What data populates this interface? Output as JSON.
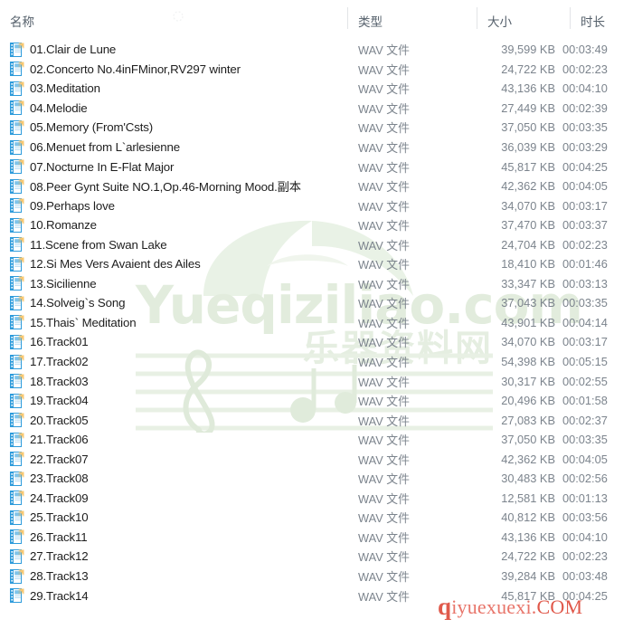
{
  "window": {
    "view_type": "file-list-details"
  },
  "columns": {
    "name": "名称",
    "type": "类型",
    "size": "大小",
    "duration": "时长"
  },
  "watermarks": {
    "center_text": "Yueqiziliao.com",
    "center_text_cn": "乐器资料网",
    "bottom_q": "q",
    "bottom_text": "iyuexuexi.",
    "bottom_tld": "COM"
  },
  "files": [
    {
      "icon": "wav-file-icon",
      "name": "01.Clair de Lune",
      "type": "WAV 文件",
      "size": "39,599 KB",
      "duration": "00:03:49"
    },
    {
      "icon": "wav-file-icon",
      "name": "02.Concerto No.4inFMinor,RV297 winter",
      "type": "WAV 文件",
      "size": "24,722 KB",
      "duration": "00:02:23"
    },
    {
      "icon": "wav-file-icon",
      "name": "03.Meditation",
      "type": "WAV 文件",
      "size": "43,136 KB",
      "duration": "00:04:10"
    },
    {
      "icon": "wav-file-icon",
      "name": "04.Melodie",
      "type": "WAV 文件",
      "size": "27,449 KB",
      "duration": "00:02:39"
    },
    {
      "icon": "wav-file-icon",
      "name": "05.Memory (From'Csts)",
      "type": "WAV 文件",
      "size": "37,050 KB",
      "duration": "00:03:35"
    },
    {
      "icon": "wav-file-icon",
      "name": "06.Menuet from L`arlesienne",
      "type": "WAV 文件",
      "size": "36,039 KB",
      "duration": "00:03:29"
    },
    {
      "icon": "wav-file-icon",
      "name": "07.Nocturne In E-Flat Major",
      "type": "WAV 文件",
      "size": "45,817 KB",
      "duration": "00:04:25"
    },
    {
      "icon": "wav-file-icon",
      "name": "08.Peer Gynt Suite NO.1,Op.46-Morning Mood.副本",
      "type": "WAV 文件",
      "size": "42,362 KB",
      "duration": "00:04:05"
    },
    {
      "icon": "wav-file-icon",
      "name": "09.Perhaps love",
      "type": "WAV 文件",
      "size": "34,070 KB",
      "duration": "00:03:17"
    },
    {
      "icon": "wav-file-icon",
      "name": "10.Romanze",
      "type": "WAV 文件",
      "size": "37,470 KB",
      "duration": "00:03:37"
    },
    {
      "icon": "wav-file-icon",
      "name": "11.Scene from Swan Lake",
      "type": "WAV 文件",
      "size": "24,704 KB",
      "duration": "00:02:23"
    },
    {
      "icon": "wav-file-icon",
      "name": "12.Si Mes Vers Avaient des Ailes",
      "type": "WAV 文件",
      "size": "18,410 KB",
      "duration": "00:01:46"
    },
    {
      "icon": "wav-file-icon",
      "name": "13.Sicilienne",
      "type": "WAV 文件",
      "size": "33,347 KB",
      "duration": "00:03:13"
    },
    {
      "icon": "wav-file-icon",
      "name": "14.Solveig`s Song",
      "type": "WAV 文件",
      "size": "37,043 KB",
      "duration": "00:03:35"
    },
    {
      "icon": "wav-file-icon",
      "name": "15.Thais` Meditation",
      "type": "WAV 文件",
      "size": "43,901 KB",
      "duration": "00:04:14"
    },
    {
      "icon": "wav-file-icon",
      "name": "16.Track01",
      "type": "WAV 文件",
      "size": "34,070 KB",
      "duration": "00:03:17"
    },
    {
      "icon": "wav-file-icon",
      "name": "17.Track02",
      "type": "WAV 文件",
      "size": "54,398 KB",
      "duration": "00:05:15"
    },
    {
      "icon": "wav-file-icon",
      "name": "18.Track03",
      "type": "WAV 文件",
      "size": "30,317 KB",
      "duration": "00:02:55"
    },
    {
      "icon": "wav-file-icon",
      "name": "19.Track04",
      "type": "WAV 文件",
      "size": "20,496 KB",
      "duration": "00:01:58"
    },
    {
      "icon": "wav-file-icon",
      "name": "20.Track05",
      "type": "WAV 文件",
      "size": "27,083 KB",
      "duration": "00:02:37"
    },
    {
      "icon": "wav-file-icon",
      "name": "21.Track06",
      "type": "WAV 文件",
      "size": "37,050 KB",
      "duration": "00:03:35"
    },
    {
      "icon": "wav-file-icon",
      "name": "22.Track07",
      "type": "WAV 文件",
      "size": "42,362 KB",
      "duration": "00:04:05"
    },
    {
      "icon": "wav-file-icon",
      "name": "23.Track08",
      "type": "WAV 文件",
      "size": "30,483 KB",
      "duration": "00:02:56"
    },
    {
      "icon": "wav-file-icon",
      "name": "24.Track09",
      "type": "WAV 文件",
      "size": "12,581 KB",
      "duration": "00:01:13"
    },
    {
      "icon": "wav-file-icon",
      "name": "25.Track10",
      "type": "WAV 文件",
      "size": "40,812 KB",
      "duration": "00:03:56"
    },
    {
      "icon": "wav-file-icon",
      "name": "26.Track11",
      "type": "WAV 文件",
      "size": "43,136 KB",
      "duration": "00:04:10"
    },
    {
      "icon": "wav-file-icon",
      "name": "27.Track12",
      "type": "WAV 文件",
      "size": "24,722 KB",
      "duration": "00:02:23"
    },
    {
      "icon": "wav-file-icon",
      "name": "28.Track13",
      "type": "WAV 文件",
      "size": "39,284 KB",
      "duration": "00:03:48"
    },
    {
      "icon": "wav-file-icon",
      "name": "29.Track14",
      "type": "WAV 文件",
      "size": "45,817 KB",
      "duration": "00:04:25"
    }
  ],
  "colors": {
    "icon_blue": "#2d9bdb",
    "icon_blue_dark": "#1b74ab",
    "header_text": "#55606b",
    "row_text": "#1d1d1d",
    "secondary_text": "#7c848d",
    "watermark_green": "#e2ecdd",
    "watermark_red": "#e05a4c"
  }
}
